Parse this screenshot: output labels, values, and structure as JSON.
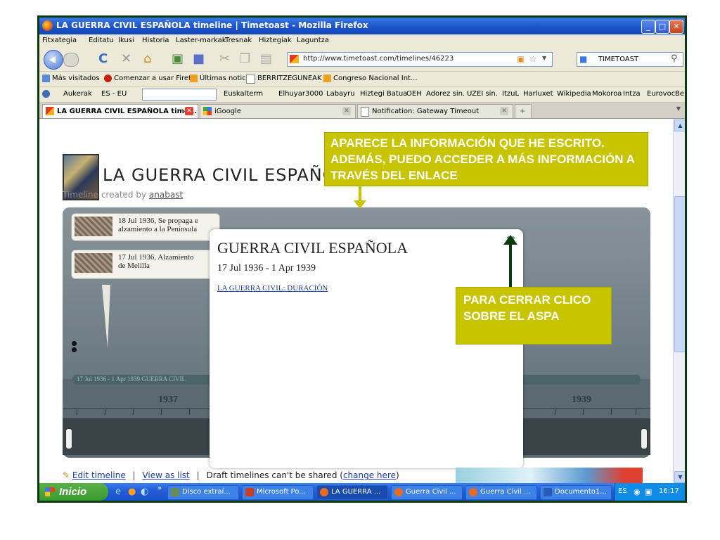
{
  "window": {
    "title": "LA GUERRA CIVIL ESPAÑOLA timeline | Timetoast - Mozilla Firefox"
  },
  "menu": [
    "Fitxategia",
    "Editatu",
    "Ikusi",
    "Historia",
    "Laster-markak",
    "Tresnak",
    "Hiztegiak",
    "Laguntza"
  ],
  "nav": {
    "url": "http://www.timetoast.com/timelines/46223",
    "search": "TIMETOAST"
  },
  "bookmarks": [
    "Más visitados",
    "Comenzar a usar Firef...",
    "Últimas noticias",
    "BERRITZEGUNEAK",
    "Congreso Nacional Int..."
  ],
  "toolbar2": {
    "aukerak": "Aukerak",
    "lang": "ES - EU",
    "items": [
      "Euskalterm",
      "Elhuyar",
      "3000",
      "Labayru",
      "Hiztegi Batua",
      "OEH",
      "Adorez sin.",
      "UZEI sin.",
      "ItzuL",
      "Harluxet",
      "Wikipedia",
      "Mokoroa",
      "Intza",
      "Eurovoc",
      "Be"
    ]
  },
  "tabs": [
    "LA GUERRA CIVIL ESPAÑOLA time...",
    "iGoogle",
    "Notification: Gateway Timeout"
  ],
  "page": {
    "title": "LA GUERRA CIVIL ESPAÑOL",
    "created_prefix": "Timeline created by",
    "author": "anabast",
    "events": [
      {
        "line1": "18 Jul 1936, Se propaga e",
        "line2": "alzamiento a la Península"
      },
      {
        "line1": "17 Jul 1936, Alzamiento",
        "line2": "de Melilla"
      }
    ],
    "band_label": "17 Jul 1936 - 1 Apr 1939  GUERRA CIVIL",
    "years": [
      "1937",
      "1939"
    ]
  },
  "modal": {
    "title": "GUERRA CIVIL ESPAÑOLA",
    "dates": "17 Jul 1936 - 1 Apr 1939",
    "link": "LA GUERRA CIVIL: DURACIÓN",
    "close": "✖"
  },
  "annotations": {
    "top": "APARECE LA INFORMACIÓN QUE HE ESCRITO. ADEMÁS, PUEDO ACCEDER A MÁS INFORMACIÓN A TRAVÉS DEL ENLACE",
    "right": "PARA CERRAR CLICO SOBRE EL ASPA"
  },
  "footer": {
    "edit": "Edit timeline",
    "view": "View as list",
    "draft": "Draft timelines can't be shared (",
    "change": "change here",
    "close_paren": ")"
  },
  "taskbar": {
    "start": "Inicio",
    "items": [
      "Disco extraí...",
      "Microsoft Po...",
      "LA GUERRA ...",
      "Guerra Civil ...",
      "Guerra Civil ...",
      "Documento1..."
    ],
    "lang": "ES",
    "time": "16:17"
  }
}
